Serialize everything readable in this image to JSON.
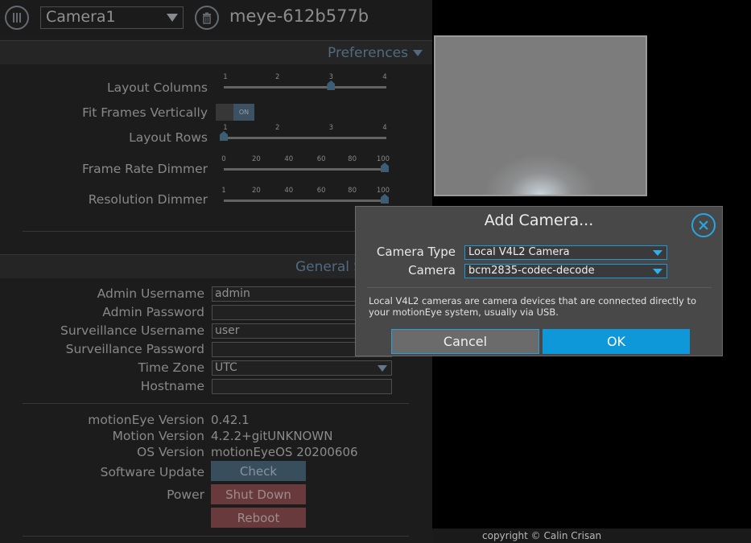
{
  "header": {
    "camera_select_value": "Camera1",
    "hostname": "meye-612b577b",
    "icons": {
      "menu": "menu-icon",
      "delete": "trash-icon"
    }
  },
  "preferences": {
    "title": "Preferences",
    "layout_columns": {
      "label": "Layout Columns",
      "ticks": [
        "1",
        "2",
        "3",
        "4"
      ],
      "value": 3
    },
    "fit_frames": {
      "label": "Fit Frames Vertically",
      "toggle": "ON"
    },
    "layout_rows": {
      "label": "Layout Rows",
      "ticks": [
        "1",
        "2",
        "3",
        "4"
      ],
      "value": 1
    },
    "frame_rate_dimmer": {
      "label": "Frame Rate Dimmer",
      "ticks": [
        "0",
        "20",
        "40",
        "60",
        "80",
        "100"
      ],
      "value": 100
    },
    "resolution_dimmer": {
      "label": "Resolution Dimmer",
      "ticks": [
        "1",
        "20",
        "40",
        "60",
        "80",
        "100"
      ],
      "value": 100
    }
  },
  "general": {
    "title": "General S",
    "admin_username": {
      "label": "Admin Username",
      "value": "admin"
    },
    "admin_password": {
      "label": "Admin Password",
      "value": ""
    },
    "surveillance_username": {
      "label": "Surveillance Username",
      "value": "user"
    },
    "surveillance_password": {
      "label": "Surveillance Password",
      "value": ""
    },
    "time_zone": {
      "label": "Time Zone",
      "value": "UTC"
    },
    "hostname": {
      "label": "Hostname",
      "value": ""
    },
    "motioneye_version": {
      "label": "motionEye Version",
      "value": "0.42.1"
    },
    "motion_version": {
      "label": "Motion Version",
      "value": "4.2.2+gitUNKNOWN"
    },
    "os_version": {
      "label": "OS Version",
      "value": "motionEyeOS 20200606"
    },
    "software_update": {
      "label": "Software Update",
      "button": "Check"
    },
    "power": {
      "label": "Power",
      "shutdown": "Shut Down",
      "reboot": "Reboot"
    }
  },
  "footer": {
    "copyright": "copyright © Calin Crisan"
  },
  "modal": {
    "title": "Add Camera...",
    "camera_type": {
      "label": "Camera Type",
      "value": "Local V4L2 Camera"
    },
    "camera": {
      "label": "Camera",
      "value": "bcm2835-codec-decode"
    },
    "description_line1": "Local V4L2 cameras are camera devices that are connected directly to",
    "description_line2": "your motionEye system, usually via USB.",
    "cancel": "Cancel",
    "ok": "OK"
  },
  "colors": {
    "accent": "#0e97d9",
    "link": "#7aa3c6",
    "danger": "#a1595c",
    "check": "#587890"
  }
}
